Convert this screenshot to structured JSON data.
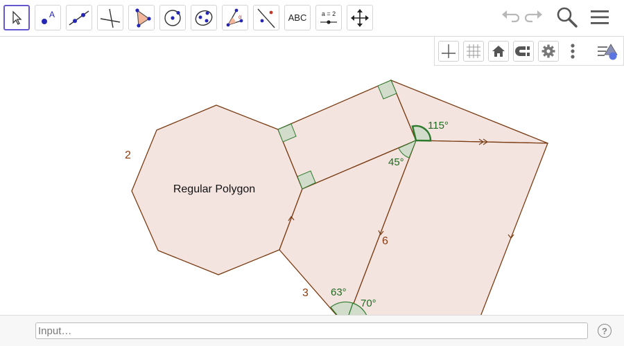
{
  "toolbar": {
    "tools": [
      {
        "name": "move",
        "label": ""
      },
      {
        "name": "point",
        "label": "A"
      },
      {
        "name": "line",
        "label": ""
      },
      {
        "name": "perpendicular-line",
        "label": ""
      },
      {
        "name": "polygon",
        "label": ""
      },
      {
        "name": "circle-center-point",
        "label": ""
      },
      {
        "name": "ellipse",
        "label": ""
      },
      {
        "name": "angle",
        "label": ""
      },
      {
        "name": "reflect-about-line",
        "label": ""
      },
      {
        "name": "text",
        "label": "ABC"
      },
      {
        "name": "slider",
        "label": "a = 2"
      },
      {
        "name": "move-graphics-view",
        "label": ""
      }
    ],
    "undo_icon": "undo-icon",
    "redo_icon": "redo-icon",
    "search_icon": "search-icon",
    "menu_icon": "hamburger-menu-icon"
  },
  "graphics_bar": {
    "icons": [
      "axes-icon",
      "grid-icon",
      "home-icon",
      "point-capturing-icon",
      "settings-icon",
      "more-vertical-icon",
      "style-bar-toggle-icon"
    ]
  },
  "canvas": {
    "polygon_label": "Regular Polygon",
    "side_labels": {
      "octagon_side": "2",
      "lower_side": "3",
      "diagonal": "6"
    },
    "angle_labels": {
      "top": "115°",
      "mid": "45°",
      "bottom_left": "63°",
      "bottom_right": "70°"
    },
    "colors": {
      "stroke": "#7a3b12",
      "fill": "#f3e4e0",
      "angle_fill": "#c8dcc8",
      "angle_stroke": "#2d7a2d",
      "label_side": "#8b3a0f",
      "label_angle": "#1e6b1e"
    }
  },
  "input_bar": {
    "placeholder": "Input…",
    "help_label": "?"
  }
}
